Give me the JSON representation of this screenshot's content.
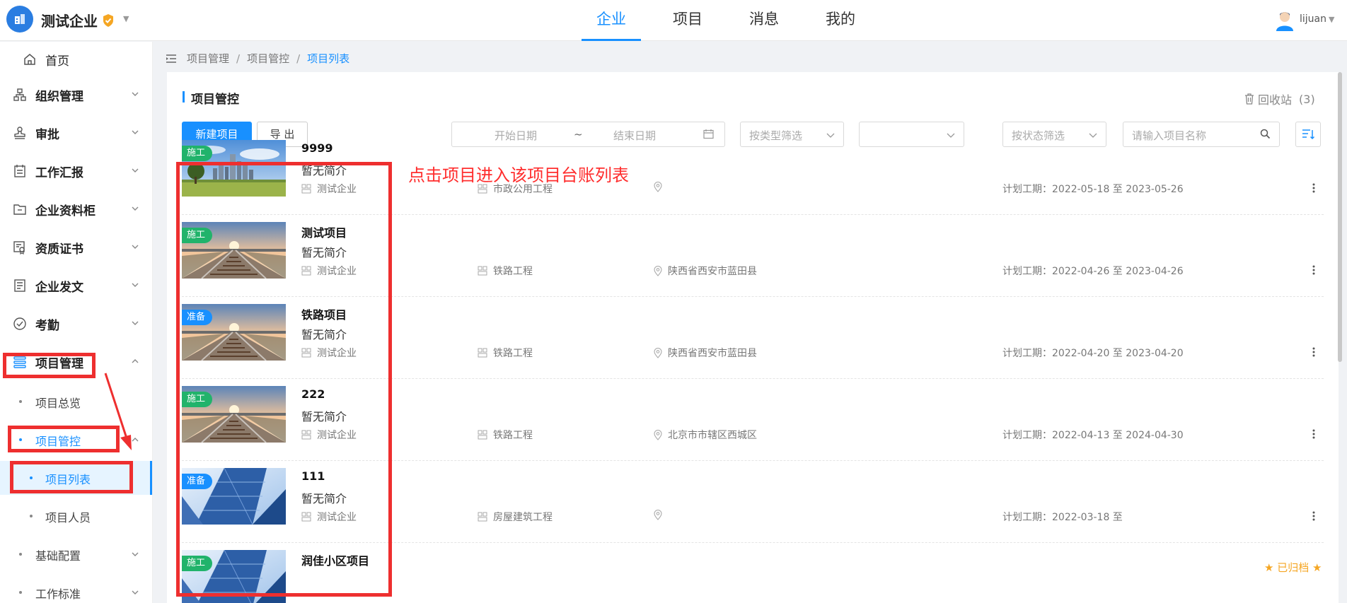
{
  "header": {
    "company": "测试企业",
    "nav": [
      "企业",
      "项目",
      "消息",
      "我的"
    ],
    "active_nav": "企业",
    "username": "lijuan"
  },
  "sidebar": {
    "home": "首页",
    "items": [
      "组织管理",
      "审批",
      "工作汇报",
      "企业资料柜",
      "资质证书",
      "企业发文",
      "考勤",
      "项目管理"
    ],
    "project_sub": [
      "项目总览",
      "项目管控"
    ],
    "control_sub": [
      "项目列表",
      "项目人员"
    ],
    "tail": [
      "基础配置",
      "工作标准"
    ]
  },
  "breadcrumb": [
    "项目管理",
    "项目管控",
    "项目列表"
  ],
  "panel": {
    "title": "项目管控",
    "recycle_label": "回收站",
    "recycle_count": "(3)",
    "new_button": "新建项目",
    "export_button": "导 出",
    "start_date_placeholder": "开始日期",
    "range_sep": "~",
    "end_date_placeholder": "结束日期",
    "type_filter_placeholder": "按类型筛选",
    "status_filter_placeholder": "按状态筛选",
    "search_placeholder": "请输入项目名称",
    "archived_label": "已归档"
  },
  "annotation": "点击项目进入该项目台账列表",
  "projects": [
    {
      "tag": "施工",
      "tag_color": "#21b36b",
      "name": "9999",
      "desc": "暂无简介",
      "org": "测试企业",
      "type": "市政公用工程",
      "location": "",
      "period_label": "计划工期：",
      "period": "2022-05-18 至 2023-05-26",
      "image": "city-skyline"
    },
    {
      "tag": "施工",
      "tag_color": "#21b36b",
      "name": "测试项目",
      "desc": "暂无简介",
      "org": "测试企业",
      "type": "铁路工程",
      "location": "陕西省西安市蓝田县",
      "period_label": "计划工期：",
      "period": "2022-04-26 至 2023-04-26",
      "image": "railway"
    },
    {
      "tag": "准备",
      "tag_color": "#1890ff",
      "name": "铁路项目",
      "desc": "暂无简介",
      "org": "测试企业",
      "type": "铁路工程",
      "location": "陕西省西安市蓝田县",
      "period_label": "计划工期：",
      "period": "2022-04-20 至 2023-04-20",
      "image": "railway"
    },
    {
      "tag": "施工",
      "tag_color": "#21b36b",
      "name": "222",
      "desc": "暂无简介",
      "org": "测试企业",
      "type": "铁路工程",
      "location": "北京市市辖区西城区",
      "period_label": "计划工期：",
      "period": "2022-04-13 至 2024-04-30",
      "image": "railway"
    },
    {
      "tag": "准备",
      "tag_color": "#1890ff",
      "name": "111",
      "desc": "暂无简介",
      "org": "测试企业",
      "type": "房屋建筑工程",
      "location": "",
      "period_label": "计划工期：",
      "period": "2022-03-18 至",
      "image": "glass-building"
    },
    {
      "tag": "施工",
      "tag_color": "#21b36b",
      "name": "润佳小区项目",
      "desc": "",
      "org": "",
      "type": "",
      "location": "",
      "period_label": "",
      "period": "",
      "image": "glass-building"
    }
  ]
}
